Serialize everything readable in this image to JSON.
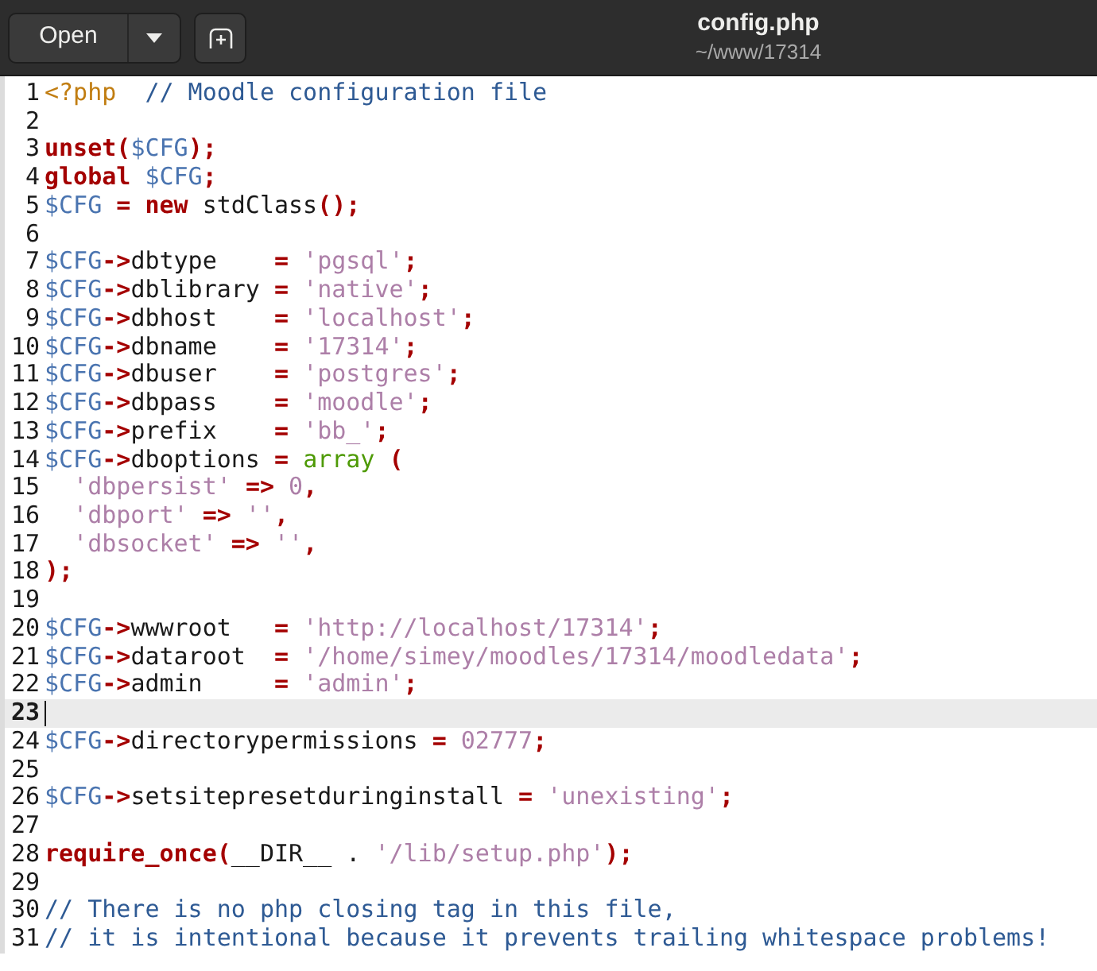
{
  "header": {
    "open_button": "Open",
    "title": "config.php",
    "subtitle": "~/www/17314"
  },
  "lines": [
    {
      "number": "1",
      "current": false,
      "tokens": [
        {
          "kind": "tag",
          "text": "<?php  "
        },
        {
          "kind": "comment",
          "text": "// Moodle configuration file"
        }
      ]
    },
    {
      "number": "2",
      "current": false
    },
    {
      "number": "3",
      "current": false,
      "tokens": [
        {
          "kind": "keyword",
          "text": "unset("
        },
        {
          "kind": "var",
          "text": "$CFG"
        },
        {
          "kind": "keyword",
          "text": ");"
        }
      ]
    },
    {
      "number": "4",
      "current": false,
      "tokens": [
        {
          "kind": "keyword",
          "text": "global "
        },
        {
          "kind": "var",
          "text": "$CFG"
        },
        {
          "kind": "keyword",
          "text": ";"
        }
      ]
    },
    {
      "number": "5",
      "current": false,
      "tokens": [
        {
          "kind": "var",
          "text": "$CFG "
        },
        {
          "kind": "keyword",
          "text": "= new"
        },
        {
          "kind": "plain",
          "text": " stdClass"
        },
        {
          "kind": "keyword",
          "text": "();"
        }
      ]
    },
    {
      "number": "6",
      "current": false
    },
    {
      "number": "7",
      "current": false,
      "tokens": [
        {
          "kind": "var",
          "text": "$CFG"
        },
        {
          "kind": "keyword",
          "text": "->"
        },
        {
          "kind": "plain",
          "text": "dbtype    "
        },
        {
          "kind": "keyword",
          "text": "= "
        },
        {
          "kind": "string",
          "text": "'pgsql'"
        },
        {
          "kind": "keyword",
          "text": ";"
        }
      ]
    },
    {
      "number": "8",
      "current": false,
      "tokens": [
        {
          "kind": "var",
          "text": "$CFG"
        },
        {
          "kind": "keyword",
          "text": "->"
        },
        {
          "kind": "plain",
          "text": "dblibrary "
        },
        {
          "kind": "keyword",
          "text": "= "
        },
        {
          "kind": "string",
          "text": "'native'"
        },
        {
          "kind": "keyword",
          "text": ";"
        }
      ]
    },
    {
      "number": "9",
      "current": false,
      "tokens": [
        {
          "kind": "var",
          "text": "$CFG"
        },
        {
          "kind": "keyword",
          "text": "->"
        },
        {
          "kind": "plain",
          "text": "dbhost    "
        },
        {
          "kind": "keyword",
          "text": "= "
        },
        {
          "kind": "string",
          "text": "'localhost'"
        },
        {
          "kind": "keyword",
          "text": ";"
        }
      ]
    },
    {
      "number": "10",
      "current": false,
      "tokens": [
        {
          "kind": "var",
          "text": "$CFG"
        },
        {
          "kind": "keyword",
          "text": "->"
        },
        {
          "kind": "plain",
          "text": "dbname    "
        },
        {
          "kind": "keyword",
          "text": "= "
        },
        {
          "kind": "string",
          "text": "'17314'"
        },
        {
          "kind": "keyword",
          "text": ";"
        }
      ]
    },
    {
      "number": "11",
      "current": false,
      "tokens": [
        {
          "kind": "var",
          "text": "$CFG"
        },
        {
          "kind": "keyword",
          "text": "->"
        },
        {
          "kind": "plain",
          "text": "dbuser    "
        },
        {
          "kind": "keyword",
          "text": "= "
        },
        {
          "kind": "string",
          "text": "'postgres'"
        },
        {
          "kind": "keyword",
          "text": ";"
        }
      ]
    },
    {
      "number": "12",
      "current": false,
      "tokens": [
        {
          "kind": "var",
          "text": "$CFG"
        },
        {
          "kind": "keyword",
          "text": "->"
        },
        {
          "kind": "plain",
          "text": "dbpass    "
        },
        {
          "kind": "keyword",
          "text": "= "
        },
        {
          "kind": "string",
          "text": "'moodle'"
        },
        {
          "kind": "keyword",
          "text": ";"
        }
      ]
    },
    {
      "number": "13",
      "current": false,
      "tokens": [
        {
          "kind": "var",
          "text": "$CFG"
        },
        {
          "kind": "keyword",
          "text": "->"
        },
        {
          "kind": "plain",
          "text": "prefix    "
        },
        {
          "kind": "keyword",
          "text": "= "
        },
        {
          "kind": "string",
          "text": "'bb_'"
        },
        {
          "kind": "keyword",
          "text": ";"
        }
      ]
    },
    {
      "number": "14",
      "current": false,
      "tokens": [
        {
          "kind": "var",
          "text": "$CFG"
        },
        {
          "kind": "keyword",
          "text": "->"
        },
        {
          "kind": "plain",
          "text": "dboptions "
        },
        {
          "kind": "keyword",
          "text": "= "
        },
        {
          "kind": "type",
          "text": "array "
        },
        {
          "kind": "keyword",
          "text": "("
        }
      ]
    },
    {
      "number": "15",
      "current": false,
      "tokens": [
        {
          "kind": "string",
          "text": "  'dbpersist' "
        },
        {
          "kind": "keyword",
          "text": "=> "
        },
        {
          "kind": "string",
          "text": "0"
        },
        {
          "kind": "keyword",
          "text": ","
        }
      ]
    },
    {
      "number": "16",
      "current": false,
      "tokens": [
        {
          "kind": "string",
          "text": "  'dbport' "
        },
        {
          "kind": "keyword",
          "text": "=> "
        },
        {
          "kind": "string",
          "text": "''"
        },
        {
          "kind": "keyword",
          "text": ","
        }
      ]
    },
    {
      "number": "17",
      "current": false,
      "tokens": [
        {
          "kind": "string",
          "text": "  'dbsocket' "
        },
        {
          "kind": "keyword",
          "text": "=> "
        },
        {
          "kind": "string",
          "text": "''"
        },
        {
          "kind": "keyword",
          "text": ","
        }
      ]
    },
    {
      "number": "18",
      "current": false,
      "tokens": [
        {
          "kind": "keyword",
          "text": ");"
        }
      ]
    },
    {
      "number": "19",
      "current": false
    },
    {
      "number": "20",
      "current": false,
      "tokens": [
        {
          "kind": "var",
          "text": "$CFG"
        },
        {
          "kind": "keyword",
          "text": "->"
        },
        {
          "kind": "plain",
          "text": "wwwroot   "
        },
        {
          "kind": "keyword",
          "text": "= "
        },
        {
          "kind": "string",
          "text": "'http://localhost/17314'"
        },
        {
          "kind": "keyword",
          "text": ";"
        }
      ]
    },
    {
      "number": "21",
      "current": false,
      "tokens": [
        {
          "kind": "var",
          "text": "$CFG"
        },
        {
          "kind": "keyword",
          "text": "->"
        },
        {
          "kind": "plain",
          "text": "dataroot  "
        },
        {
          "kind": "keyword",
          "text": "= "
        },
        {
          "kind": "string",
          "text": "'/home/simey/moodles/17314/moodledata'"
        },
        {
          "kind": "keyword",
          "text": ";"
        }
      ]
    },
    {
      "number": "22",
      "current": false,
      "tokens": [
        {
          "kind": "var",
          "text": "$CFG"
        },
        {
          "kind": "keyword",
          "text": "->"
        },
        {
          "kind": "plain",
          "text": "admin     "
        },
        {
          "kind": "keyword",
          "text": "= "
        },
        {
          "kind": "string",
          "text": "'admin'"
        },
        {
          "kind": "keyword",
          "text": ";"
        }
      ]
    },
    {
      "number": "23",
      "current": true
    },
    {
      "number": "24",
      "current": false,
      "tokens": [
        {
          "kind": "var",
          "text": "$CFG"
        },
        {
          "kind": "keyword",
          "text": "->"
        },
        {
          "kind": "plain",
          "text": "directorypermissions "
        },
        {
          "kind": "keyword",
          "text": "= "
        },
        {
          "kind": "string",
          "text": "02777"
        },
        {
          "kind": "keyword",
          "text": ";"
        }
      ]
    },
    {
      "number": "25",
      "current": false
    },
    {
      "number": "26",
      "current": false,
      "tokens": [
        {
          "kind": "var",
          "text": "$CFG"
        },
        {
          "kind": "keyword",
          "text": "->"
        },
        {
          "kind": "plain",
          "text": "setsitepresetduringinstall "
        },
        {
          "kind": "keyword",
          "text": "= "
        },
        {
          "kind": "string",
          "text": "'unexisting'"
        },
        {
          "kind": "keyword",
          "text": ";"
        }
      ]
    },
    {
      "number": "27",
      "current": false
    },
    {
      "number": "28",
      "current": false,
      "tokens": [
        {
          "kind": "keyword",
          "text": "require_once("
        },
        {
          "kind": "plain",
          "text": "__DIR__ . "
        },
        {
          "kind": "string",
          "text": "'/lib/setup.php'"
        },
        {
          "kind": "keyword",
          "text": ");"
        }
      ]
    },
    {
      "number": "29",
      "current": false
    },
    {
      "number": "30",
      "current": false,
      "tokens": [
        {
          "kind": "comment",
          "text": "// There is no php closing tag in this file,"
        }
      ]
    },
    {
      "number": "31",
      "current": false,
      "tokens": [
        {
          "kind": "comment",
          "text": "// it is intentional because it prevents trailing whitespace problems!"
        }
      ]
    }
  ]
}
